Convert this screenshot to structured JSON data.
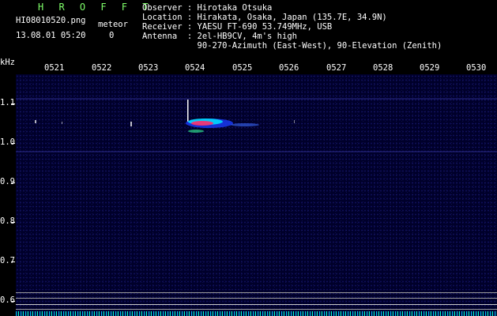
{
  "header": {
    "title": "H R O F F T",
    "filename": "HI08010520.png",
    "meteor_label": "meteor",
    "datetime": "13.08.01 05:20",
    "meteor_count": "0",
    "observer": "Observer : Hirotaka Otsuka",
    "location": "Location : Hirakata, Osaka, Japan (135.7E, 34.9N)",
    "receiver": "Receiver : YAESU FT-690 53.749MHz, USB",
    "antenna": "Antenna  : 2el-HB9CV, 4m's high",
    "antenna_detail": "           90-270-Azimuth (East-West), 90-Elevation (Zenith)"
  },
  "axis": {
    "y_unit": "kHz",
    "y_ticks": [
      "1.1",
      "1.0",
      "0.9",
      "0.8",
      "0.7",
      "0.6"
    ],
    "x_ticks": [
      "0521",
      "0522",
      "0523",
      "0524",
      "0525",
      "0526",
      "0527",
      "0528",
      "0529",
      "0530"
    ]
  },
  "colors": {
    "title": "#7fff6a",
    "background": "#000000",
    "spectrum_background": "#00002a",
    "echo_core": "#ff2b6b",
    "echo_mid": "#00e5ff",
    "echo_edge": "#3a6bff"
  }
}
